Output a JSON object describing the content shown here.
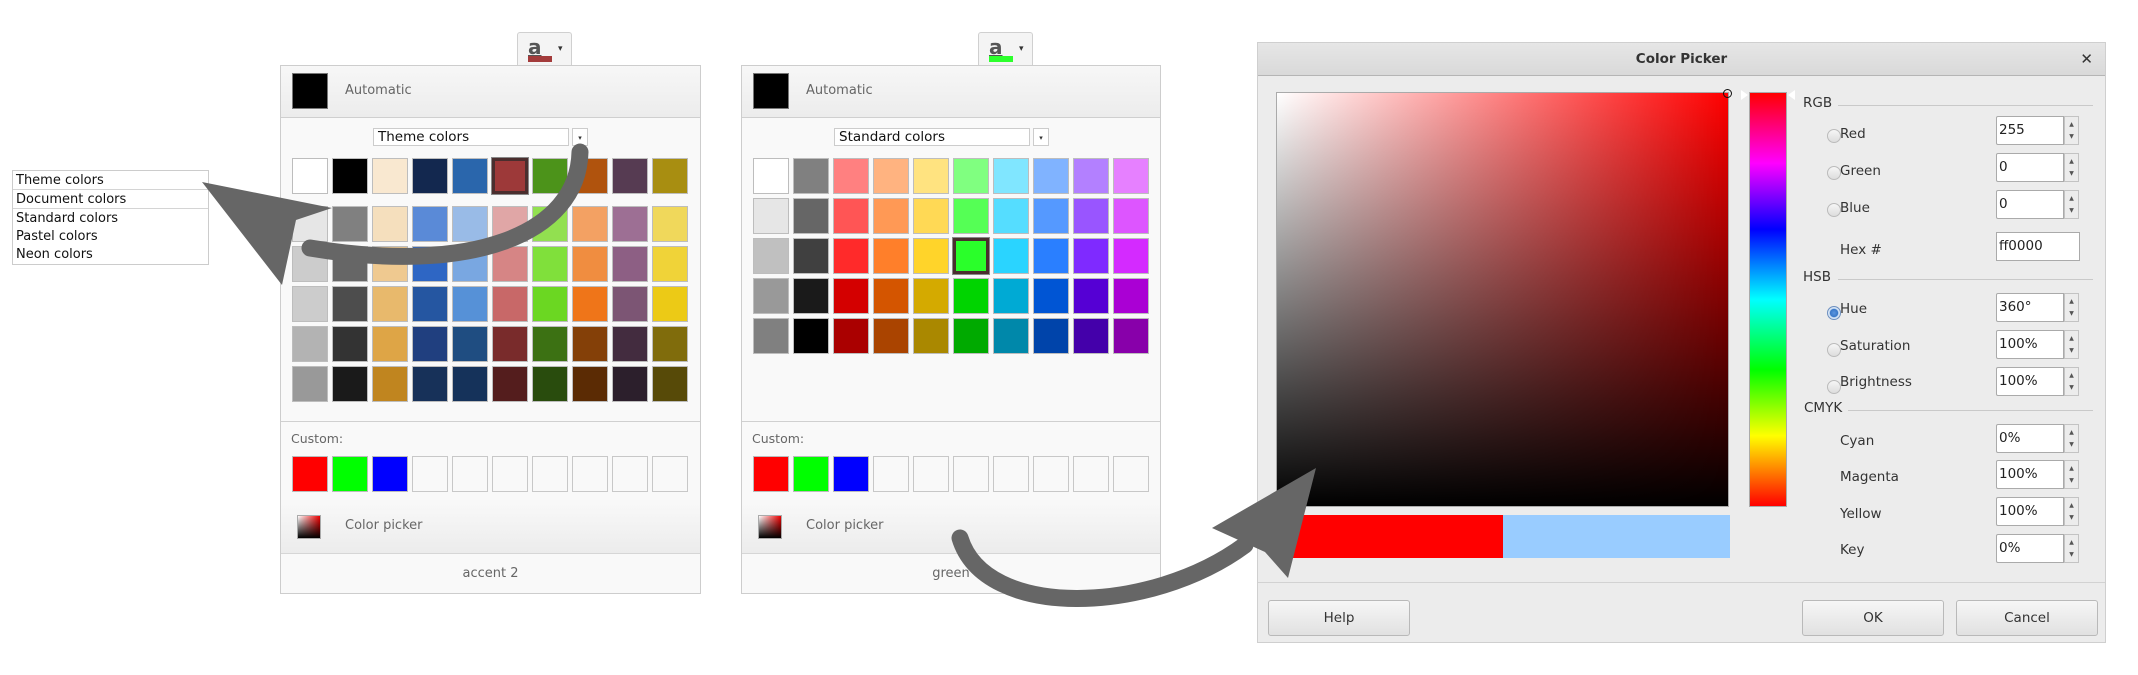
{
  "toolbar_buttons": [
    {
      "glyph": "a",
      "color_bar": "#a33b3b",
      "dropdown_icon": "▾"
    },
    {
      "glyph": "a",
      "color_bar": "#2cff2c",
      "dropdown_icon": "▾"
    }
  ],
  "palette_list": {
    "items": [
      "Theme colors",
      "Document colors",
      "Standard colors",
      "Pastel colors",
      "Neon colors"
    ]
  },
  "panels": [
    {
      "automatic_label": "Automatic",
      "automatic_color": "#000000",
      "palette_select": "Theme colors",
      "palette_select_caret": "▾",
      "custom_label": "Custom:",
      "custom_colors": [
        "#ff0000",
        "#00ff00",
        "#0000ff",
        "",
        "",
        "",
        "",
        "",
        "",
        ""
      ],
      "color_picker_label": "Color picker",
      "status": "accent 2",
      "selected": [
        0,
        5
      ],
      "rows": [
        [
          "#ffffff",
          "#000000",
          "#f9e8d0",
          "#13284f",
          "#2a66ac",
          "#9d3939",
          "#4c931a",
          "#b0530d",
          "#563b52",
          "#a88e11"
        ],
        [
          "#e6e6e6",
          "#808080",
          "#f5dfbd",
          "#5a8ad7",
          "#99bbe7",
          "#e0a6a6",
          "#92e050",
          "#f3a163",
          "#9d6f94",
          "#f0d85b"
        ],
        [
          "#cccccc",
          "#666666",
          "#efc990",
          "#2e66c4",
          "#79a7e1",
          "#d68585",
          "#80e03b",
          "#f08d40",
          "#8d5f84",
          "#f0d338"
        ],
        [
          "#cccccc",
          "#4d4d4d",
          "#e8b96c",
          "#2556a1",
          "#5691d7",
          "#c86868",
          "#6bd722",
          "#ef7519",
          "#7c5574",
          "#ecca16"
        ],
        [
          "#b3b3b3",
          "#333333",
          "#dea546",
          "#203f7f",
          "#1f4d81",
          "#792b2b",
          "#3c7113",
          "#844008",
          "#432c3f",
          "#806c0c"
        ],
        [
          "#999999",
          "#1a1a1a",
          "#c0851f",
          "#173159",
          "#15325a",
          "#541d1d",
          "#294c0d",
          "#5b2b04",
          "#2c1f2c",
          "#574a08"
        ]
      ]
    },
    {
      "automatic_label": "Automatic",
      "automatic_color": "#000000",
      "palette_select": "Standard colors",
      "palette_select_caret": "▾",
      "custom_label": "Custom:",
      "custom_colors": [
        "#ff0000",
        "#00ff00",
        "#0000ff",
        "",
        "",
        "",
        "",
        "",
        "",
        ""
      ],
      "color_picker_label": "Color picker",
      "status": "green",
      "selected": [
        2,
        5
      ],
      "rows": [
        [
          "#ffffff",
          "#808080",
          "#ff8080",
          "#ffb380",
          "#ffe380",
          "#80ff80",
          "#80e6ff",
          "#80b3ff",
          "#b380ff",
          "#e680ff"
        ],
        [
          "#e6e6e6",
          "#666666",
          "#ff5555",
          "#ff9955",
          "#ffd955",
          "#55ff55",
          "#55ddff",
          "#5599ff",
          "#9955ff",
          "#dd55ff"
        ],
        [
          "#c0c0c0",
          "#404040",
          "#ff2a2a",
          "#ff7f2a",
          "#ffd42a",
          "#2aff2a",
          "#2ad4ff",
          "#2a7fff",
          "#7f2aff",
          "#d42aff"
        ],
        [
          "#999999",
          "#1a1a1a",
          "#d40000",
          "#d45500",
          "#d4aa00",
          "#00d400",
          "#00aad4",
          "#0055d4",
          "#5500d4",
          "#aa00d4"
        ],
        [
          "#808080",
          "#000000",
          "#aa0000",
          "#aa4400",
          "#aa8800",
          "#00aa00",
          "#0088aa",
          "#0044aa",
          "#4400aa",
          "#8800aa"
        ]
      ]
    }
  ],
  "dialog": {
    "title": "Color Picker",
    "close_icon": "✕",
    "current_hue_color": "#ff0000",
    "new_color": "#ff0000",
    "old_color": "#99ccff",
    "rgb_group": "RGB",
    "hsb_group": "HSB",
    "cmyk_group": "CMYK",
    "fields": {
      "red": {
        "label": "Red",
        "value": "255"
      },
      "green": {
        "label": "Green",
        "value": "0"
      },
      "blue": {
        "label": "Blue",
        "value": "0"
      },
      "hex": {
        "label": "Hex #",
        "value": "ff0000"
      },
      "hue": {
        "label": "Hue",
        "value": "360°"
      },
      "saturation": {
        "label": "Saturation",
        "value": "100%"
      },
      "brightness": {
        "label": "Brightness",
        "value": "100%"
      },
      "cyan": {
        "label": "Cyan",
        "value": "0%"
      },
      "magenta": {
        "label": "Magenta",
        "value": "100%"
      },
      "yellow": {
        "label": "Yellow",
        "value": "100%"
      },
      "key": {
        "label": "Key",
        "value": "0%"
      }
    },
    "selected_mode": "hue",
    "spin_up": "▲",
    "spin_down": "▼",
    "buttons": {
      "help": "Help",
      "ok": "OK",
      "cancel": "Cancel"
    }
  },
  "annotation_arrow_color": "#666666"
}
